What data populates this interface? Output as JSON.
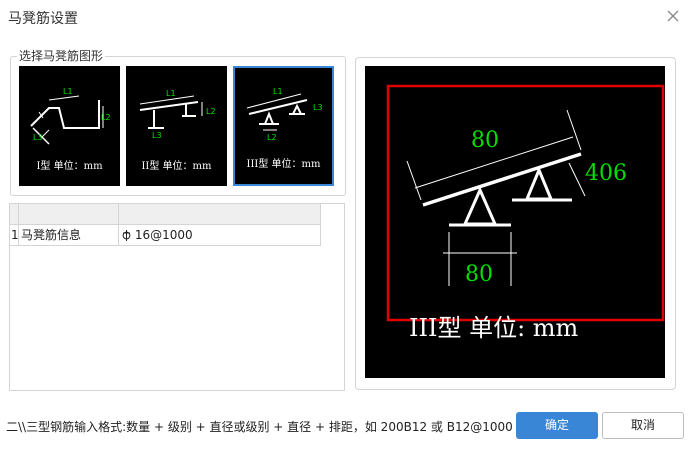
{
  "window": {
    "title": "马凳筋设置"
  },
  "shape_group": {
    "legend": "选择马凳筋图形",
    "thumbnails": [
      {
        "label": "I型 单位：mm",
        "dims": [
          "L1",
          "L2",
          "L3"
        ],
        "selected": false
      },
      {
        "label": "II型 单位：mm",
        "dims": [
          "L1",
          "L2",
          "L3"
        ],
        "selected": false
      },
      {
        "label": "III型 单位：mm",
        "dims": [
          "L1",
          "L2",
          "L3"
        ],
        "selected": true
      }
    ]
  },
  "grid": {
    "rows": [
      {
        "index": "1",
        "name": "马凳筋信息",
        "value": " 16@1000"
      }
    ]
  },
  "preview": {
    "dim_top": "80",
    "dim_right": "406",
    "dim_bottom": "80",
    "caption": "III型  单位:  mm",
    "highlight_color": "#e00000",
    "dim_color": "#00e000"
  },
  "footer": {
    "hint": "二\\\\三型钢筋输入格式:数量 + 级别 + 直径或级别 + 直径 + 排距，如 200B12 或 B12@1000",
    "ok_label": "确定",
    "cancel_label": "取消"
  },
  "accent_color": "#3a86d6"
}
